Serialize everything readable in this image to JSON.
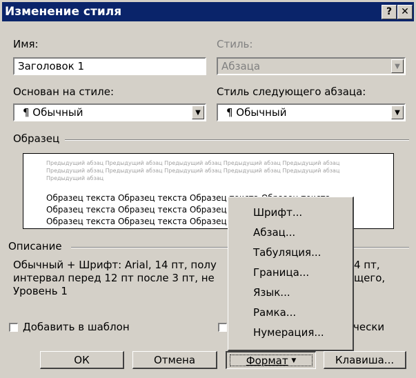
{
  "window": {
    "title": "Изменение стиля",
    "help_label": "?",
    "close_label": "✕"
  },
  "name": {
    "label": "Имя:",
    "value": "Заголовок 1"
  },
  "style_type": {
    "label": "Стиль:",
    "value": "Абзаца"
  },
  "based_on": {
    "label": "Основан на стиле:",
    "value": "¶ Обычный"
  },
  "next_style": {
    "label": "Стиль следующего абзаца:",
    "value": "¶ Обычный"
  },
  "preview": {
    "group_label": "Образец",
    "prev_paragraph": "Предыдущий абзац Предыдущий абзац Предыдущий абзац Предыдущий абзац Предыдущий абзац Предыдущий абзац Предыдущий абзац Предыдущий абзац Предыдущий абзац Предыдущий абзац Предыдущий абзац",
    "sample_text": "Образец текста Образец текста Образец текста Образец текста Образец текста Образец текста Образец текста Образец текста Образец текста Образец текста Образец"
  },
  "description": {
    "group_label": "Описание",
    "text": "Обычный + Шрифт: Arial, 14 пт, полу… 4 пт, интервал перед 12 пт после 3 пт, не… …щего, Уровень 1",
    "line1": "Обычный + Шрифт: Arial, 14 пт, полу",
    "line1_tail": "4 пт,",
    "line2": "интервал перед 12 пт после 3 пт, не",
    "line2_tail": "щего,",
    "line3": "Уровень 1"
  },
  "checkboxes": {
    "add_template": "Добавить в шаблон",
    "auto_update_tail": "чески"
  },
  "buttons": {
    "ok": "ОК",
    "cancel": "Отмена",
    "format": "Формат",
    "format_arrow": "▼",
    "shortcut": "Клавиша..."
  },
  "format_menu": {
    "items": [
      "Шрифт...",
      "Абзац...",
      "Табуляция...",
      "Граница...",
      "Язык...",
      "Рамка...",
      "Нумерация..."
    ]
  }
}
